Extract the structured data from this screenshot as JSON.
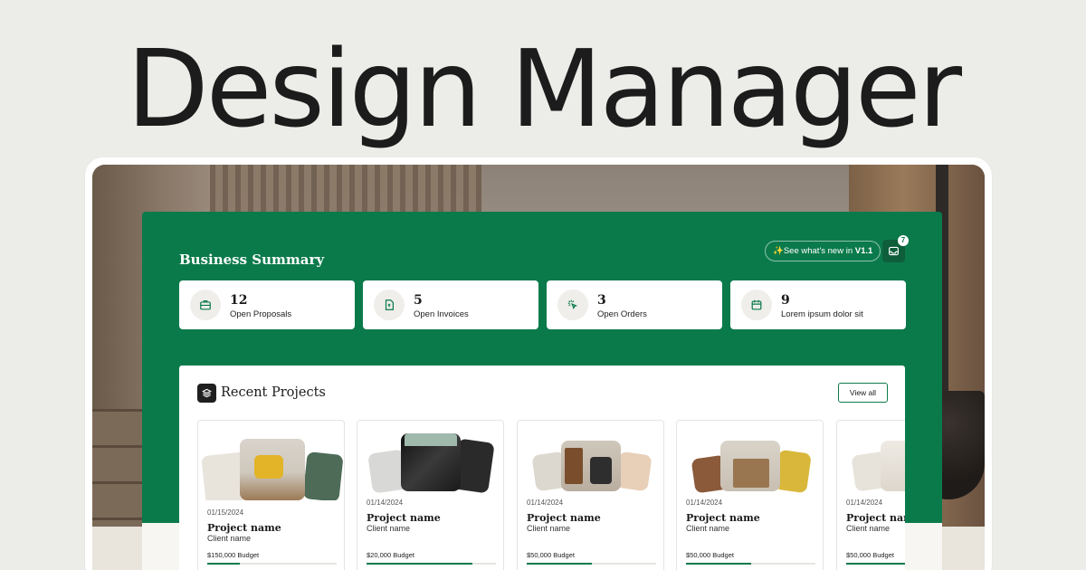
{
  "hero": {
    "title": "Design Manager"
  },
  "summary": {
    "title": "Business Summary",
    "whats_new_prefix": "✨See what's new in ",
    "whats_new_version": "V1.1",
    "inbox_count": "7",
    "stats": [
      {
        "value": "12",
        "label": "Open Proposals",
        "icon": "briefcase-icon"
      },
      {
        "value": "5",
        "label": "Open Invoices",
        "icon": "invoice-icon"
      },
      {
        "value": "3",
        "label": "Open Orders",
        "icon": "cursor-click-icon"
      },
      {
        "value": "9",
        "label": "Lorem ipsum dolor sit",
        "icon": "calendar-icon"
      }
    ]
  },
  "projects": {
    "title": "Recent Projects",
    "view_all_label": "View all",
    "items": [
      {
        "date": "01/15/2024",
        "name": "Project name",
        "client": "Client name",
        "budget": "$150,000 Budget",
        "progress": 0.25
      },
      {
        "date": "01/14/2024",
        "name": "Project name",
        "client": "Client name",
        "budget": "$20,000 Budget",
        "progress": 0.82
      },
      {
        "date": "01/14/2024",
        "name": "Project name",
        "client": "Client name",
        "budget": "$50,000 Budget",
        "progress": 0.5
      },
      {
        "date": "01/14/2024",
        "name": "Project name",
        "client": "Client name",
        "budget": "$50,000 Budget",
        "progress": 0.5
      },
      {
        "date": "01/14/2024",
        "name": "Project name",
        "client": "Client name",
        "budget": "$50,000 Budget",
        "progress": 0.5
      }
    ]
  },
  "colors": {
    "brand_green": "#0b7a4b",
    "background": "#ecede8"
  }
}
